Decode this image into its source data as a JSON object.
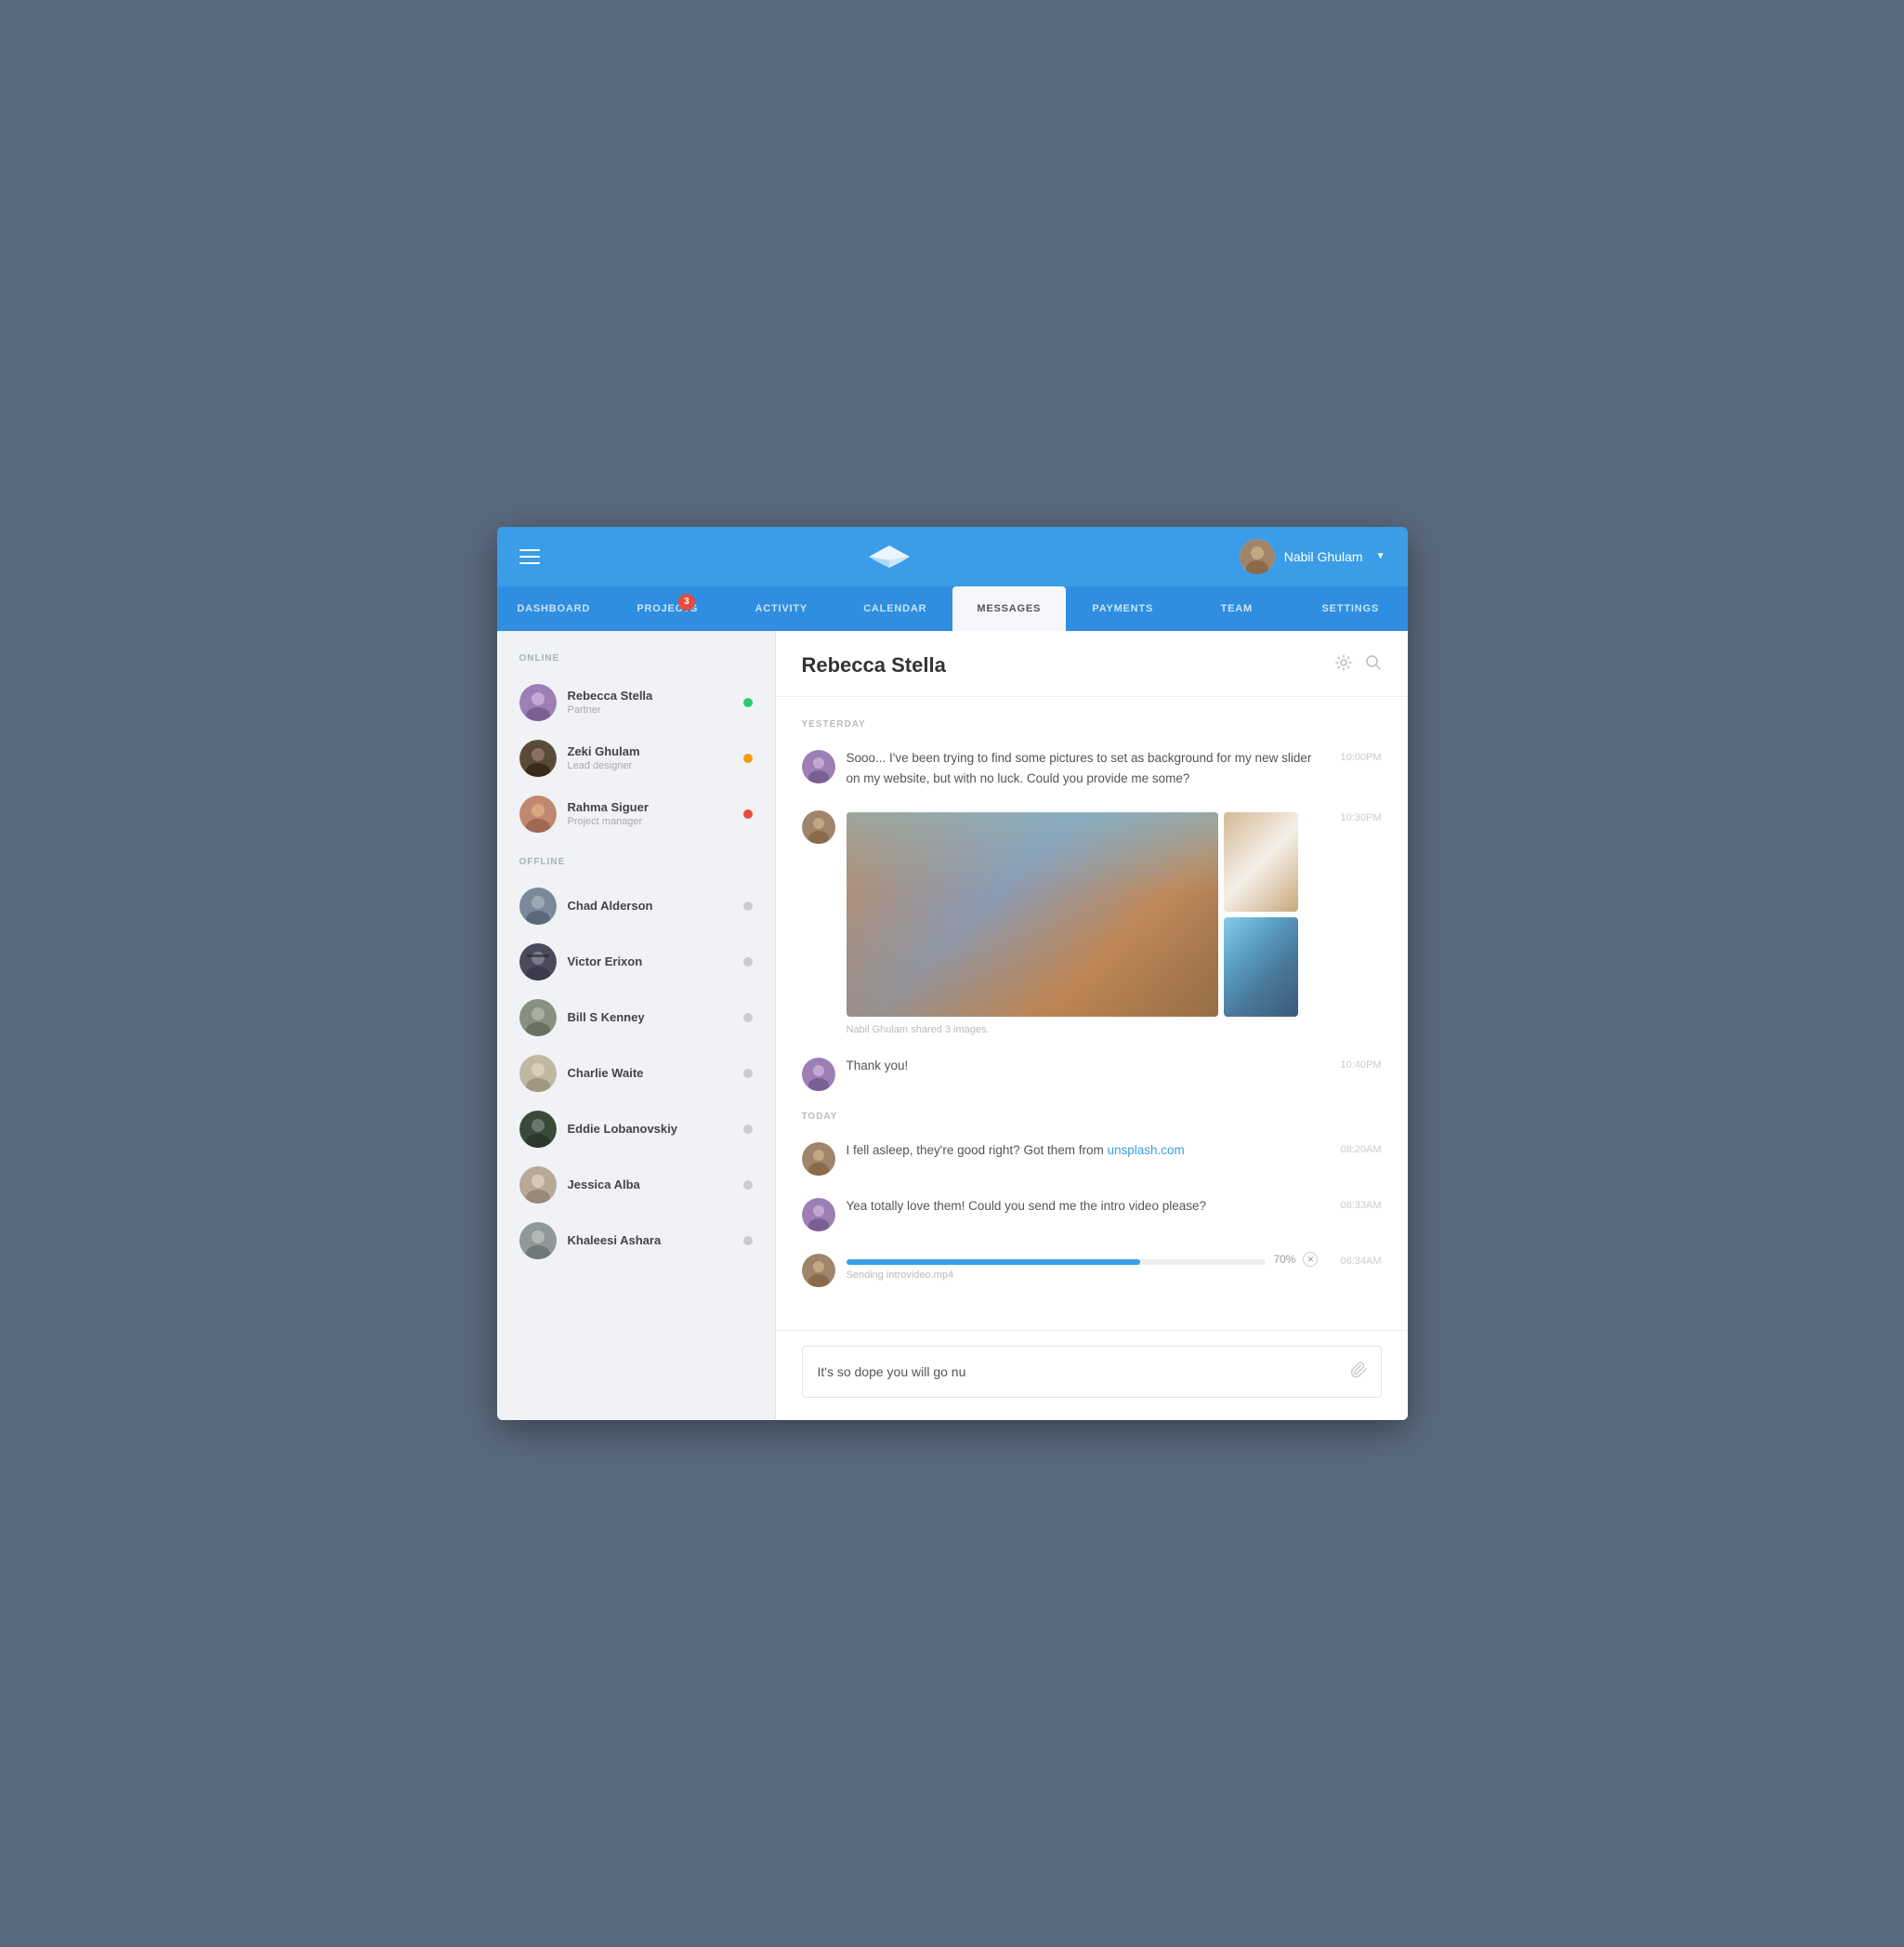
{
  "header": {
    "logo_alt": "App Logo",
    "user_name": "Nabil Ghulam",
    "user_caret": "▼"
  },
  "nav": {
    "items": [
      {
        "id": "dashboard",
        "label": "DASHBOARD",
        "active": false,
        "badge": null
      },
      {
        "id": "projects",
        "label": "PROJECTS",
        "active": false,
        "badge": "3"
      },
      {
        "id": "activity",
        "label": "ACTIVITY",
        "active": false,
        "badge": null
      },
      {
        "id": "calendar",
        "label": "CALENDAR",
        "active": false,
        "badge": null
      },
      {
        "id": "messages",
        "label": "MESSAGES",
        "active": true,
        "badge": null
      },
      {
        "id": "payments",
        "label": "PAYMENTS",
        "active": false,
        "badge": null
      },
      {
        "id": "team",
        "label": "TEAM",
        "active": false,
        "badge": null
      },
      {
        "id": "settings",
        "label": "SETTINGS",
        "active": false,
        "badge": null
      }
    ]
  },
  "sidebar": {
    "online_label": "ONLINE",
    "offline_label": "OFFLINE",
    "online_contacts": [
      {
        "id": "rebecca",
        "name": "Rebecca Stella",
        "role": "Partner",
        "status": "green"
      },
      {
        "id": "zeki",
        "name": "Zeki Ghulam",
        "role": "Lead designer",
        "status": "orange"
      },
      {
        "id": "rahma",
        "name": "Rahma Siguer",
        "role": "Project manager",
        "status": "red"
      }
    ],
    "offline_contacts": [
      {
        "id": "chad",
        "name": "Chad Alderson",
        "status": "gray"
      },
      {
        "id": "victor",
        "name": "Victor Erixon",
        "status": "gray"
      },
      {
        "id": "bill",
        "name": "Bill S Kenney",
        "status": "gray"
      },
      {
        "id": "charlie",
        "name": "Charlie Waite",
        "status": "gray"
      },
      {
        "id": "eddie",
        "name": "Eddie Lobanovskiy",
        "status": "gray"
      },
      {
        "id": "jessica",
        "name": "Jessica Alba",
        "status": "gray"
      },
      {
        "id": "khaleesi",
        "name": "Khaleesi Ashara",
        "status": "gray"
      }
    ]
  },
  "chat": {
    "contact_name": "Rebecca Stella",
    "yesterday_label": "YESTERDAY",
    "today_label": "TODAY",
    "messages": [
      {
        "id": "msg1",
        "sender": "rebecca",
        "text": "Sooo... I've been trying to find some pictures to set as background for my new slider on my website, but with no luck. Could you provide me some?",
        "time": "10:00PM",
        "type": "text"
      },
      {
        "id": "msg2",
        "sender": "nabil",
        "text": "",
        "time": "10:30PM",
        "type": "images",
        "caption": "Nabil Ghulam shared 3 images."
      },
      {
        "id": "msg3",
        "sender": "rebecca",
        "text": "Thank you!",
        "time": "10:40PM",
        "type": "text"
      },
      {
        "id": "msg4",
        "sender": "nabil",
        "text_before": "I fell asleep, they're good right? Got them from ",
        "link_text": "unsplash.com",
        "link_href": "#",
        "time": "08:20AM",
        "type": "text_link",
        "section": "today"
      },
      {
        "id": "msg5",
        "sender": "rebecca",
        "text": "Yea totally love them! Could you send me the intro video please?",
        "time": "08:33AM",
        "type": "text"
      },
      {
        "id": "msg6",
        "sender": "nabil",
        "progress": 70,
        "filename": "Sending introvideo.mp4",
        "time": "08:34AM",
        "type": "progress"
      }
    ],
    "input_placeholder": "It's so dope you will go nu",
    "input_value": "It's so dope you will go nu"
  }
}
